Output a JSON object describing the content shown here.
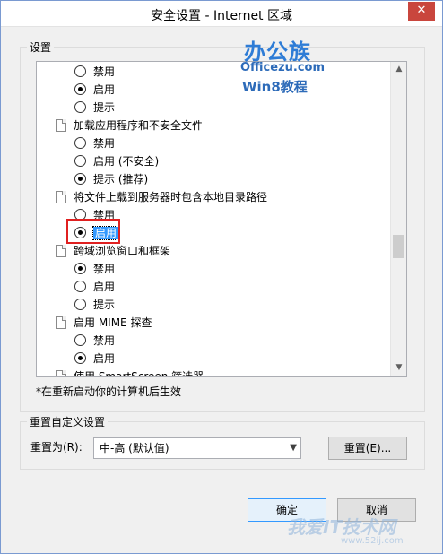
{
  "window": {
    "title": "安全设置 - Internet 区域",
    "close_glyph": "✕"
  },
  "settings_group": {
    "label": "设置",
    "rows": [
      {
        "kind": "option",
        "label": "禁用",
        "checked": false
      },
      {
        "kind": "option",
        "label": "启用",
        "checked": true
      },
      {
        "kind": "option",
        "label": "提示",
        "checked": false
      },
      {
        "kind": "category",
        "label": "加载应用程序和不安全文件"
      },
      {
        "kind": "option",
        "label": "禁用",
        "checked": false
      },
      {
        "kind": "option",
        "label": "启用 (不安全)",
        "checked": false
      },
      {
        "kind": "option",
        "label": "提示 (推荐)",
        "checked": true
      },
      {
        "kind": "category",
        "label": "将文件上载到服务器时包含本地目录路径"
      },
      {
        "kind": "option",
        "label": "禁用",
        "checked": false
      },
      {
        "kind": "option",
        "label": "启用",
        "checked": true,
        "selected": true
      },
      {
        "kind": "category",
        "label": "跨域浏览窗口和框架"
      },
      {
        "kind": "option",
        "label": "禁用",
        "checked": true
      },
      {
        "kind": "option",
        "label": "启用",
        "checked": false
      },
      {
        "kind": "option",
        "label": "提示",
        "checked": false
      },
      {
        "kind": "category",
        "label": "启用 MIME 探查"
      },
      {
        "kind": "option",
        "label": "禁用",
        "checked": false
      },
      {
        "kind": "option",
        "label": "启用",
        "checked": true
      },
      {
        "kind": "category",
        "label": "使用 SmartScreen 筛选器"
      }
    ],
    "note": "*在重新启动你的计算机后生效"
  },
  "reset_group": {
    "label": "重置自定义设置",
    "reset_to_label": "重置为(R):",
    "selected_level": "中-高 (默认值)",
    "reset_button": "重置(E)..."
  },
  "buttons": {
    "ok": "确定",
    "cancel": "取消"
  },
  "logo": {
    "main": "办公族",
    "url": "Officezu.com",
    "sub": "Win8教程"
  },
  "watermark": {
    "main": "我爱IT技术网",
    "url": "www.52ij.com"
  },
  "colors": {
    "title_close": "#c9463d",
    "selection": "#3399ff",
    "highlight": "#e02020"
  }
}
